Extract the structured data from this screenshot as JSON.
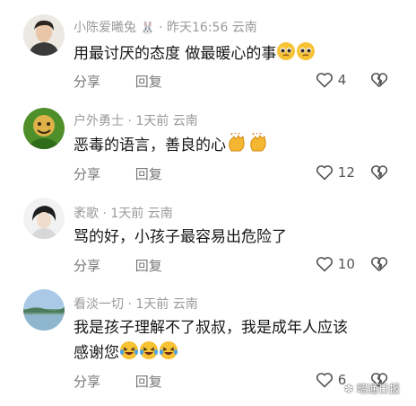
{
  "comments": [
    {
      "user": "小陈爱曦兔",
      "time": "昨天16:56",
      "location": "云南",
      "text": "用最讨厌的态度 做最暖心的事",
      "emoji": [
        "pleading-face",
        "pleading-face"
      ],
      "share_label": "分享",
      "reply_label": "回复",
      "likes": "4"
    },
    {
      "user": "户外勇士",
      "time": "1天前",
      "location": "云南",
      "text": "恶毒的语言，善良的心",
      "emoji": [
        "clapping-hands",
        "clapping-hands"
      ],
      "share_label": "分享",
      "reply_label": "回复",
      "likes": "12"
    },
    {
      "user": "袤歌",
      "time": "1天前",
      "location": "云南",
      "text": "骂的好，小孩子最容易出危险了",
      "emoji": [],
      "share_label": "分享",
      "reply_label": "回复",
      "likes": "10"
    },
    {
      "user": "看淡一切",
      "time": "1天前",
      "location": "云南",
      "text_line1": "我是孩子理解不了叔叔，我是成年人应该",
      "text_line2": "感谢您",
      "emoji": [
        "laughing-tears",
        "laughing-tears",
        "laughing-tears"
      ],
      "share_label": "分享",
      "reply_label": "回复",
      "likes": "6"
    }
  ],
  "watermark": "昭通日报",
  "colors": {
    "meta": "#9a9a9a",
    "text": "#161616",
    "emoji_yellow": "#f7c234"
  }
}
